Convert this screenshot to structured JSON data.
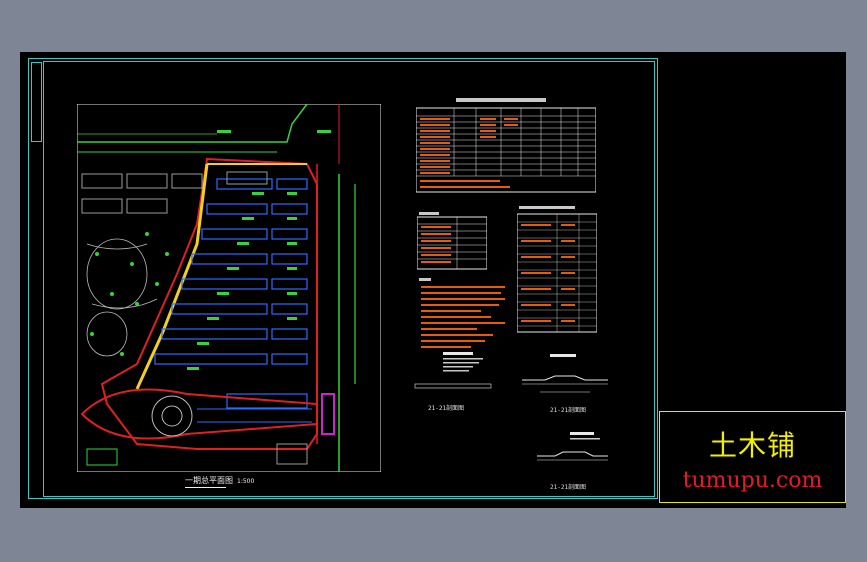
{
  "drawing": {
    "plan_title": "一期总平面图",
    "plan_scale": "1:500",
    "section_labels": [
      "21-21剖面图",
      "21-21剖面图",
      "21-21剖面图"
    ]
  },
  "logo": {
    "name_cn": "土木铺",
    "url": "tumupu.com"
  },
  "colors": {
    "background": "#7e8594",
    "sheet": "#000000",
    "frame": "#38c8c8",
    "logo_text": "#f2ef00",
    "logo_url": "#e8182a"
  }
}
